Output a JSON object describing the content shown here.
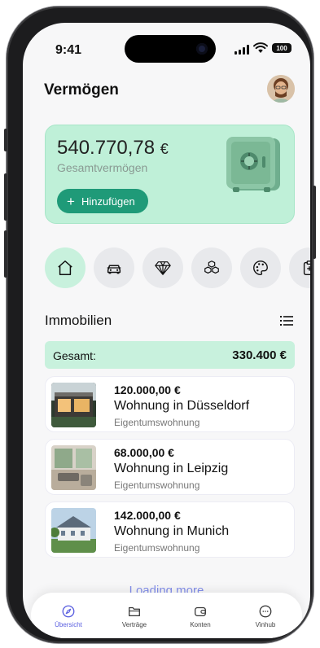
{
  "status_bar": {
    "time": "9:41",
    "battery": "100"
  },
  "header": {
    "title": "Vermögen"
  },
  "summary": {
    "amount": "540.770,78",
    "currency": "€",
    "label": "Gesamtvermögen",
    "add_button": "Hinzufügen"
  },
  "categories": [
    {
      "icon": "house-icon",
      "active": true
    },
    {
      "icon": "car-icon",
      "active": false
    },
    {
      "icon": "diamond-icon",
      "active": false
    },
    {
      "icon": "boxes-icon",
      "active": false
    },
    {
      "icon": "palette-icon",
      "active": false
    },
    {
      "icon": "clipboard-icon",
      "active": false
    }
  ],
  "section": {
    "title": "Immobilien",
    "total_label": "Gesamt:",
    "total_value": "330.400 €"
  },
  "properties": [
    {
      "price": "120.000,00 €",
      "name": "Wohnung in Düsseldorf",
      "type": "Eigentumswohnung"
    },
    {
      "price": "68.000,00 €",
      "name": "Wohnung in Leipzig",
      "type": "Eigentumswohnung"
    },
    {
      "price": "142.000,00 €",
      "name": "Wohnung in Munich",
      "type": "Eigentumswohnung"
    }
  ],
  "loading_text": "Loading more",
  "tabs": [
    {
      "label": "Übersicht",
      "icon": "compass-icon",
      "active": true
    },
    {
      "label": "Verträge",
      "icon": "folder-icon",
      "active": false
    },
    {
      "label": "Konten",
      "icon": "wallet-icon",
      "active": false
    },
    {
      "label": "Vinhub",
      "icon": "chat-icon",
      "active": false
    }
  ],
  "colors": {
    "accent": "#1f9a78",
    "mint": "#c8f1dd",
    "tab_active": "#5a5fe0"
  }
}
